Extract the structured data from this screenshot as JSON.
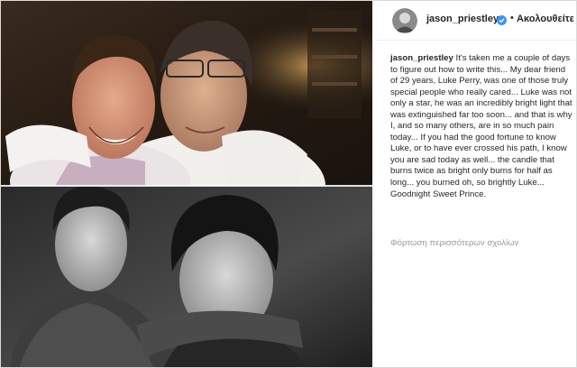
{
  "post": {
    "username": "jason_priestley",
    "separator": "•",
    "follow_label": "Ακολουθείτε",
    "verified_icon": "verified-badge-icon",
    "caption_user": "jason_priestley",
    "caption_text": "It's taken me a couple of days to figure out how to write this... My dear friend of 29 years, Luke Perry, was one of those truly special people who really cared... Luke was not only a star, he was an incredibly bright light that was extinguished far too soon... and that is why I, and so many others, are in so much pain today... If you had the good fortune to know Luke, or to have ever crossed his path, I know you are sad today as well... the candle that burns twice as bright only burns for half as long... you burned oh, so brightly Luke... Goodnight Sweet Prince.",
    "load_more_label": "Φόρτωση περισσότερων σχολίων"
  },
  "colors": {
    "accent_blue": "#3897f0",
    "text": "#262626",
    "muted": "#999999",
    "border": "#efefef"
  }
}
